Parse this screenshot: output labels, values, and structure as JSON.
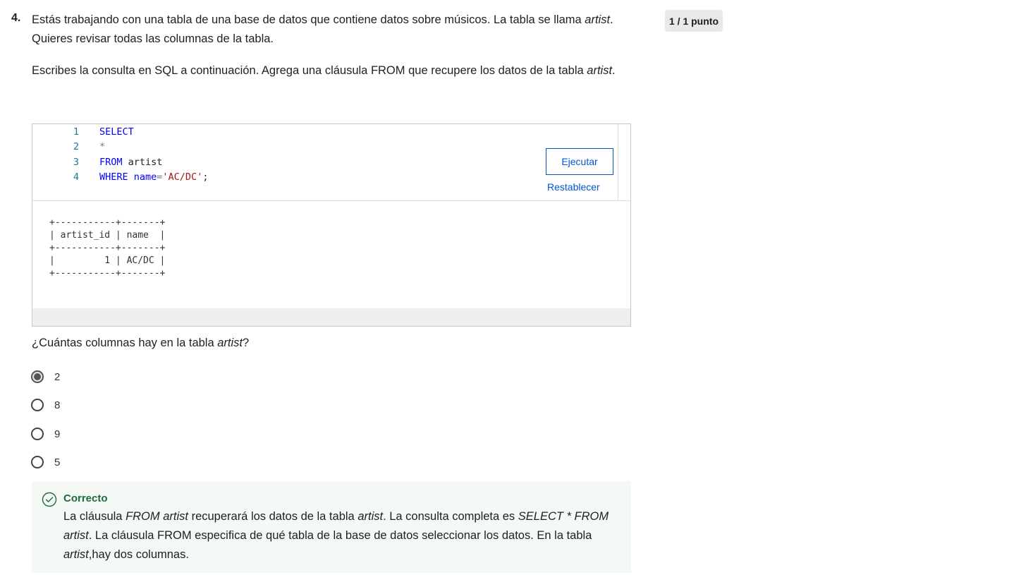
{
  "question": {
    "number": "4.",
    "line1_pre": "Estás trabajando con una tabla de una base de datos que contiene datos sobre músicos. La tabla se llama ",
    "line1_em": "artist",
    "line1_post": ". Quieres revisar todas las columnas de la tabla.",
    "line2_pre": "Escribes la consulta en SQL a continuación. Agrega una cláusula FROM que recupere los datos de la tabla ",
    "line2_em": "artist",
    "line2_post": ".",
    "points": "1 / 1 punto"
  },
  "editor": {
    "lines": [
      {
        "num": "1",
        "kw": "SELECT"
      },
      {
        "num": "2",
        "op": "*"
      },
      {
        "num": "3",
        "kw": "FROM",
        "rest": " artist"
      },
      {
        "num": "4",
        "kw": "WHERE",
        "kw2": " name",
        "op": "=",
        "str": "'AC/DC'",
        "rest": ";"
      }
    ],
    "run_label": "Ejecutar",
    "reset_label": "Restablecer"
  },
  "output": {
    "table_text": "+-----------+-------+\n| artist_id | name  |\n+-----------+-------+\n|         1 | AC/DC |\n+-----------+-------+"
  },
  "question2": {
    "pre": "¿Cuántas columnas hay en la tabla ",
    "em": "artist",
    "post": "?"
  },
  "options": [
    {
      "label": "2",
      "selected": true
    },
    {
      "label": "8",
      "selected": false
    },
    {
      "label": "9",
      "selected": false
    },
    {
      "label": "5",
      "selected": false
    }
  ],
  "feedback": {
    "title": "Correcto",
    "t1": "La cláusula ",
    "e1": "FROM artist",
    "t2": " recuperará los datos de la tabla ",
    "e2": "artist",
    "t3": ". La consulta completa es ",
    "e3": "SELECT * FROM artist",
    "t4": ". La cláusula FROM especifica de qué tabla de la base de datos seleccionar los datos. En la tabla ",
    "e4": "artist",
    "t5": ",hay dos columnas."
  },
  "colors": {
    "accent": "#0056d2",
    "success": "#1d6b3f",
    "feedback_bg": "#f4f9f6",
    "keyword": "#0000ff",
    "string": "#a31515"
  }
}
